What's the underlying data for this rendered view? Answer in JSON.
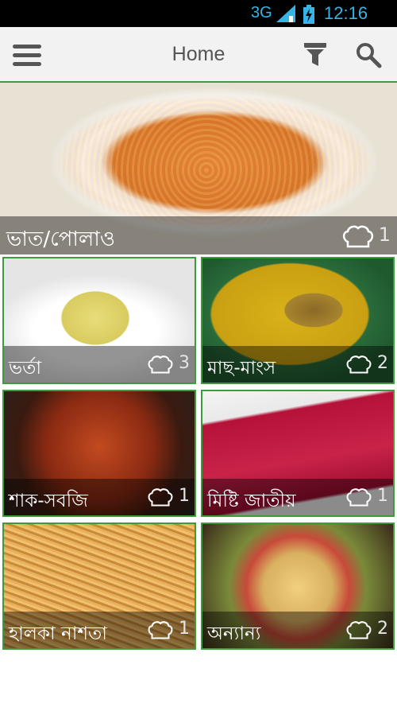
{
  "status_bar": {
    "network": "3G",
    "time": "12:16 AM"
  },
  "action_bar": {
    "title": "Home"
  },
  "colors": {
    "accent_green": "#3d9a3d",
    "status_blue": "#34b5e5"
  },
  "featured": {
    "label": "ভাত/পোলাও",
    "count": "1",
    "icon": "chef-hat-icon"
  },
  "categories": [
    {
      "label": "ভর্তা",
      "count": "3",
      "icon": "chef-hat-icon"
    },
    {
      "label": "মাছ-মাংস",
      "count": "2",
      "icon": "chef-hat-icon"
    },
    {
      "label": "শাক-সবজি",
      "count": "1",
      "icon": "chef-hat-icon"
    },
    {
      "label": "মিষ্টি জাতীয়",
      "count": "1",
      "icon": "chef-hat-icon"
    },
    {
      "label": "হালকা নাশতা",
      "count": "1",
      "icon": "chef-hat-icon"
    },
    {
      "label": "অন্যান্য",
      "count": "2",
      "icon": "chef-hat-icon"
    }
  ]
}
